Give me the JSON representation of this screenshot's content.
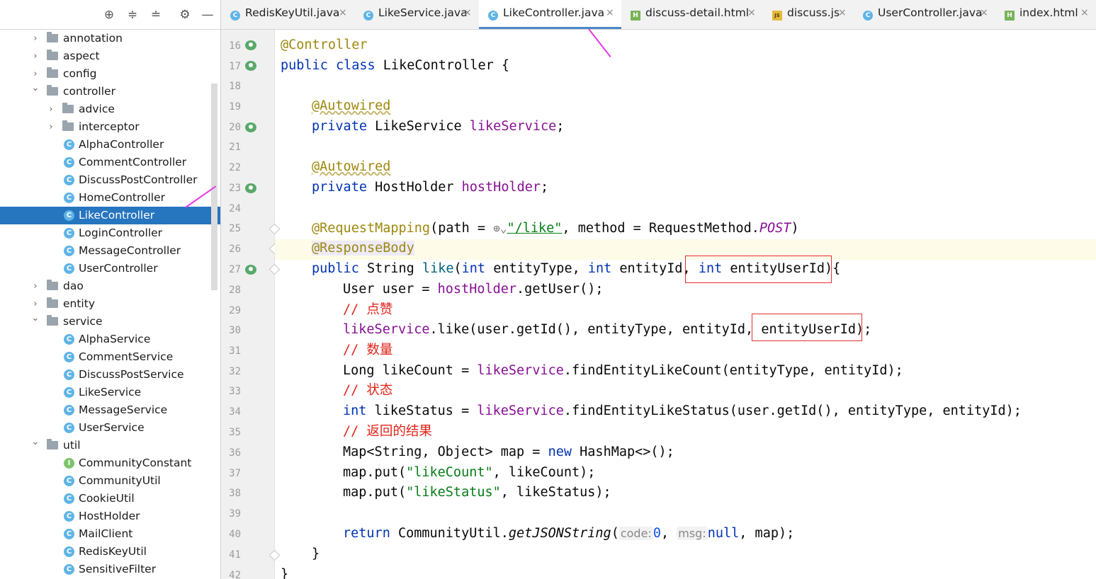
{
  "tabs": [
    {
      "label": "RedisKeyUtil.java",
      "icon": "class-icon",
      "close": "×"
    },
    {
      "label": "LikeService.java",
      "icon": "class-icon",
      "close": "×"
    },
    {
      "label": "LikeController.java",
      "icon": "class-icon",
      "close": "×",
      "active": true
    },
    {
      "label": "discuss-detail.html",
      "icon": "html-icon",
      "close": "×"
    },
    {
      "label": "discuss.js",
      "icon": "js-icon",
      "close": "×"
    },
    {
      "label": "UserController.java",
      "icon": "class-icon",
      "close": "×"
    },
    {
      "label": "index.html",
      "icon": "html-icon",
      "close": "×"
    }
  ],
  "tree": [
    {
      "label": "annotation",
      "type": "folder",
      "expanded": false
    },
    {
      "label": "aspect",
      "type": "folder",
      "expanded": false
    },
    {
      "label": "config",
      "type": "folder",
      "expanded": false
    },
    {
      "label": "controller",
      "type": "folder",
      "expanded": true
    },
    {
      "label": "advice",
      "type": "folder",
      "expanded": false
    },
    {
      "label": "interceptor",
      "type": "folder",
      "expanded": false
    },
    {
      "label": "AlphaController",
      "type": "class"
    },
    {
      "label": "CommentController",
      "type": "class"
    },
    {
      "label": "DiscussPostController",
      "type": "class"
    },
    {
      "label": "HomeController",
      "type": "class"
    },
    {
      "label": "LikeController",
      "type": "class",
      "selected": true
    },
    {
      "label": "LoginController",
      "type": "class"
    },
    {
      "label": "MessageController",
      "type": "class"
    },
    {
      "label": "UserController",
      "type": "class"
    },
    {
      "label": "dao",
      "type": "folder",
      "expanded": false
    },
    {
      "label": "entity",
      "type": "folder",
      "expanded": false
    },
    {
      "label": "service",
      "type": "folder",
      "expanded": true
    },
    {
      "label": "AlphaService",
      "type": "class"
    },
    {
      "label": "CommentService",
      "type": "class"
    },
    {
      "label": "DiscussPostService",
      "type": "class"
    },
    {
      "label": "LikeService",
      "type": "class"
    },
    {
      "label": "MessageService",
      "type": "class"
    },
    {
      "label": "UserService",
      "type": "class"
    },
    {
      "label": "util",
      "type": "folder",
      "expanded": true
    },
    {
      "label": "CommunityConstant",
      "type": "interface"
    },
    {
      "label": "CommunityUtil",
      "type": "class"
    },
    {
      "label": "CookieUtil",
      "type": "class"
    },
    {
      "label": "HostHolder",
      "type": "class"
    },
    {
      "label": "MailClient",
      "type": "class"
    },
    {
      "label": "RedisKeyUtil",
      "type": "class"
    },
    {
      "label": "SensitiveFilter",
      "type": "class"
    }
  ],
  "line_numbers": [
    "16",
    "17",
    "18",
    "19",
    "20",
    "21",
    "22",
    "23",
    "24",
    "25",
    "26",
    "27",
    "28",
    "29",
    "30",
    "31",
    "32",
    "33",
    "34",
    "35",
    "36",
    "37",
    "38",
    "39",
    "40",
    "41",
    "42"
  ],
  "code": {
    "l16": {
      "a": "@Controller"
    },
    "l17": {
      "a": "public class",
      "b": " LikeController {"
    },
    "l19": {
      "a": "@Autowired"
    },
    "l20": {
      "a": "private",
      "b": " LikeService ",
      "c": "likeService",
      "d": ";"
    },
    "l22": {
      "a": "@Autowired"
    },
    "l23": {
      "a": "private",
      "b": " HostHolder ",
      "c": "hostHolder",
      "d": ";"
    },
    "l25": {
      "a": "@RequestMapping",
      "b": "(path = ",
      "c": "\"/like\"",
      "d": ", method = RequestMethod.",
      "e": "POST",
      "f": ")"
    },
    "l26": {
      "a": "@ResponseBody"
    },
    "l27": {
      "a": "public",
      "b": " String ",
      "c": "like",
      "d": "(",
      "e": "int",
      "f": " entityType, ",
      "g": "int",
      "h": " entityId, ",
      "i": "int",
      "j": " entityUserId){"
    },
    "l28": {
      "a": "User user = ",
      "b": "hostHolder",
      "c": ".getUser();"
    },
    "l29": {
      "a": "// 点赞"
    },
    "l30": {
      "a": "likeService",
      "b": ".like(user.getId(), entityType, entityId, entityUserId);"
    },
    "l31": {
      "a": "// 数量"
    },
    "l32": {
      "a": "Long likeCount = ",
      "b": "likeService",
      "c": ".findEntityLikeCount(entityType, entityId);"
    },
    "l33": {
      "a": "// 状态"
    },
    "l34": {
      "a": "int",
      "b": " likeStatus = ",
      "c": "likeService",
      "d": ".findEntityLikeStatus(user.getId(), entityType, entityId);"
    },
    "l35": {
      "a": "// 返回的结果"
    },
    "l36": {
      "a": "Map<String, Object> map = ",
      "b": "new",
      "c": " HashMap<>();"
    },
    "l37": {
      "a": "map.put(",
      "b": "\"likeCount\"",
      "c": ", likeCount);"
    },
    "l38": {
      "a": "map.put(",
      "b": "\"likeStatus\"",
      "c": ", likeStatus);"
    },
    "l40": {
      "a": "return",
      "b": " CommunityUtil.",
      "c": "getJSONString",
      "d": "(",
      "e": "code:",
      "f": "0",
      "g": ", ",
      "h": "msg:",
      "i": "null",
      "j": ", map);"
    },
    "l41": {
      "a": "}"
    },
    "l42": {
      "a": "}"
    }
  }
}
